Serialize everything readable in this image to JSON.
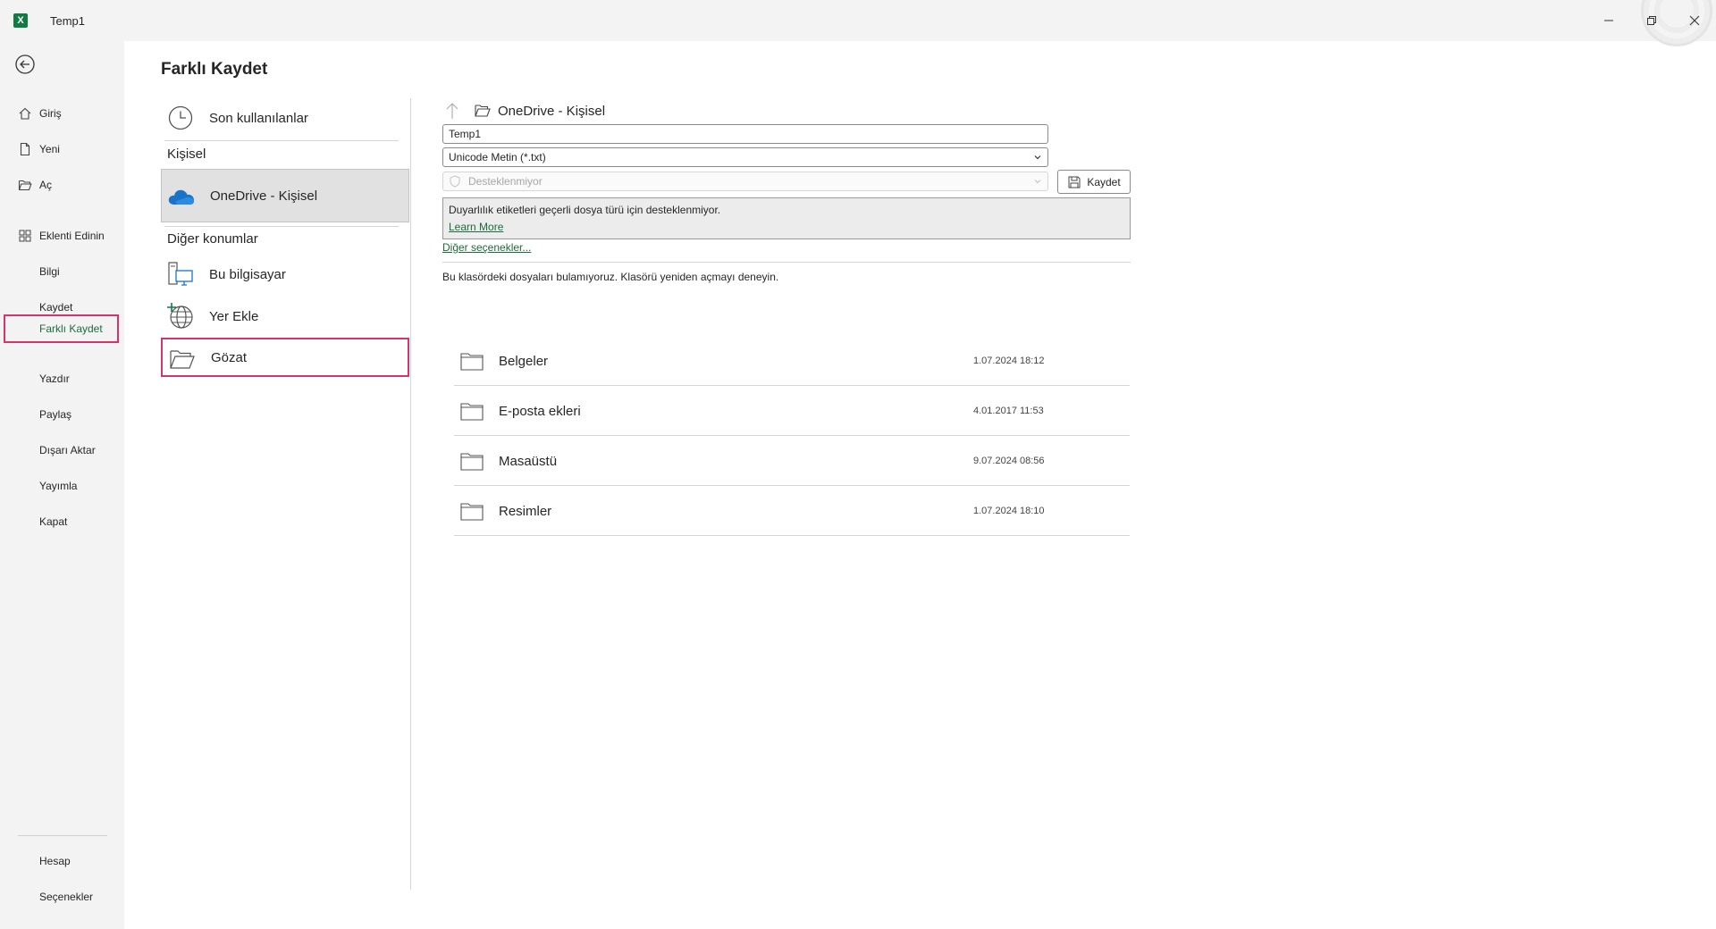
{
  "window": {
    "doc_title": "Temp1",
    "app_icon_letter": "X",
    "accent": "#107c41",
    "highlight_color": "#d6336c"
  },
  "nav": {
    "items": [
      {
        "label": "Giriş",
        "icon": "home-icon"
      },
      {
        "label": "Yeni",
        "icon": "new-document-icon"
      },
      {
        "label": "Aç",
        "icon": "open-folder-icon"
      },
      {
        "label": "Eklenti Edinin",
        "icon": "add-ins-icon"
      },
      {
        "label": "Bilgi",
        "icon": ""
      },
      {
        "label": "Kaydet",
        "icon": ""
      },
      {
        "label": "Farklı Kaydet",
        "icon": "",
        "selected": true
      },
      {
        "label": "Yazdır",
        "icon": ""
      },
      {
        "label": "Paylaş",
        "icon": ""
      },
      {
        "label": "Dışarı Aktar",
        "icon": ""
      },
      {
        "label": "Yayımla",
        "icon": ""
      },
      {
        "label": "Kapat",
        "icon": ""
      }
    ],
    "bottom": [
      {
        "label": "Hesap"
      },
      {
        "label": "Seçenekler"
      }
    ]
  },
  "main": {
    "title": "Farklı Kaydet",
    "locations": {
      "recent": "Son kullanılanlar",
      "personal_heading": "Kişisel",
      "onedrive": "OneDrive - Kişisel",
      "other_heading": "Diğer konumlar",
      "this_pc": "Bu bilgisayar",
      "add_place": "Yer Ekle",
      "browse": "Gözat"
    },
    "right": {
      "breadcrumb": "OneDrive - Kişisel",
      "filename_value": "Temp1",
      "filetype_value": "Unicode Metin (*.txt)",
      "sensitivity_value": "Desteklenmiyor",
      "save_label": "Kaydet",
      "info_text": "Duyarlılık etiketleri geçerli dosya türü için desteklenmiyor.",
      "learn_more": "Learn More",
      "more_options": "Diğer seçenekler...",
      "empty_message": "Bu klasördeki dosyaları bulamıyoruz. Klasörü yeniden açmayı deneyin.",
      "folders": [
        {
          "name": "Belgeler",
          "date": "1.07.2024 18:12"
        },
        {
          "name": "E-posta ekleri",
          "date": "4.01.2017 11:53"
        },
        {
          "name": "Masaüstü",
          "date": "9.07.2024 08:56"
        },
        {
          "name": "Resimler",
          "date": "1.07.2024 18:10"
        }
      ]
    }
  }
}
